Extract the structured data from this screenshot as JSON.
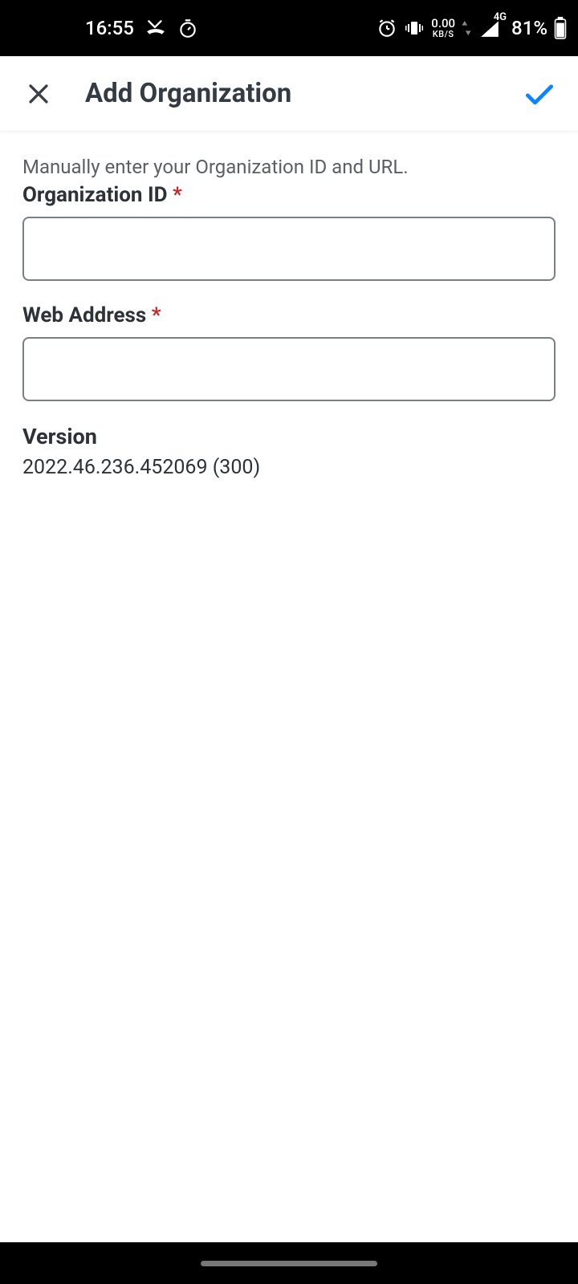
{
  "status": {
    "time": "16:55",
    "net_speed_value": "0.00",
    "net_speed_unit": "KB/S",
    "network_type": "4G",
    "battery_percent": "81%"
  },
  "appbar": {
    "title": "Add Organization"
  },
  "form": {
    "intro": "Manually enter your Organization ID and URL.",
    "org_id_label": "Organization ID",
    "org_id_value": "",
    "web_address_label": "Web Address",
    "web_address_value": "",
    "required_marker": "*"
  },
  "version": {
    "label": "Version",
    "value": "2022.46.236.452069 (300)"
  }
}
